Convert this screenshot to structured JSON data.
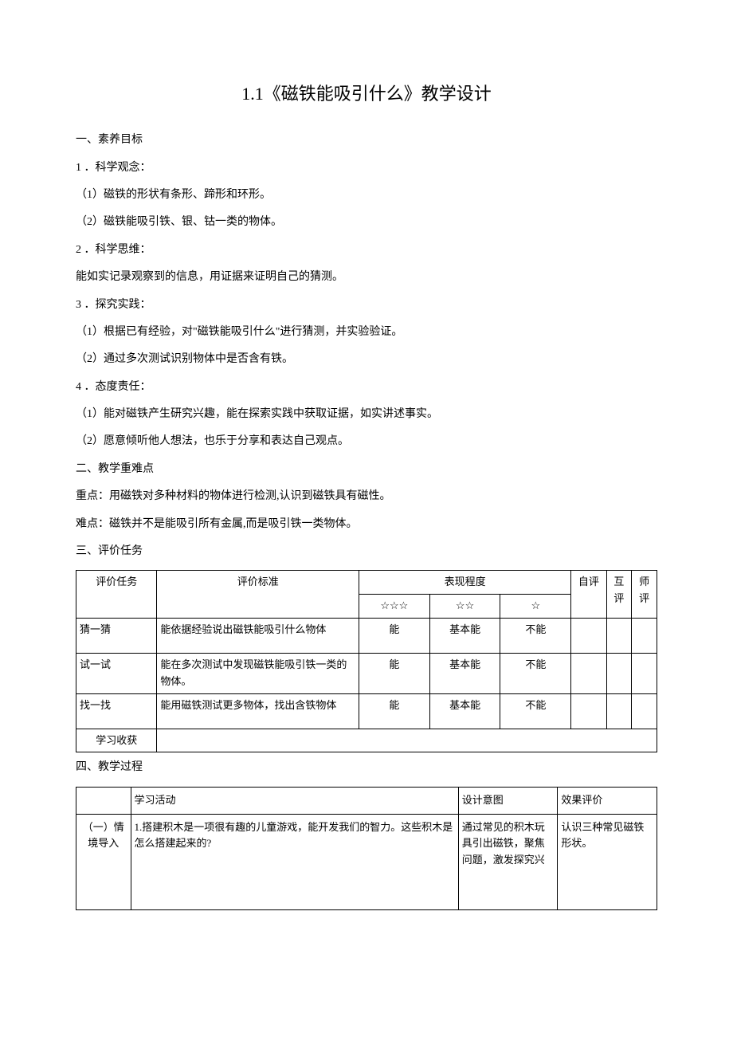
{
  "title": "1.1《磁铁能吸引什么》教学设计",
  "sec1": {
    "heading": "一、素养目标",
    "item1": "1 ．科学观念：",
    "item1_1": "（1）磁铁的形状有条形、蹄形和环形。",
    "item1_2": "（2）磁铁能吸引铁、银、钴一类的物体。",
    "item2": "2 ．科学思维：",
    "item2_1": "能如实记录观察到的信息，用证据来证明自己的猜测。",
    "item3": "3 ．探究实践：",
    "item3_1": "（1）根据已有经验，对\"磁铁能吸引什么\"进行猜测，并实验验证。",
    "item3_2": "（2）通过多次测试识别物体中是否含有铁。",
    "item4": "4 ．态度责任：",
    "item4_1": "（1）能对磁铁产生研究兴趣，能在探索实践中获取证据，如实讲述事实。",
    "item4_2": "（2）愿意倾听他人想法，也乐于分享和表达自己观点。"
  },
  "sec2": {
    "heading": "二、教学重难点",
    "line1": "重点：用磁铁对多种材料的物体进行检测,认识到磁铁具有磁性。",
    "line2": "难点：磁铁并不是能吸引所有金属,而是吸引铁一类物体。"
  },
  "sec3": {
    "heading": "三、评价任务",
    "t1": {
      "h_task": "评价任务",
      "h_std": "评价标准",
      "h_perf": "表现程度",
      "h_self": "自评",
      "h_peer": "互评",
      "h_teacher": "师评",
      "star3": "☆☆☆",
      "star2": "☆☆",
      "star1": "☆",
      "r1_task": "猜一猜",
      "r1_std": "能依据经验说出磁铁能吸引什么物体",
      "r1_p1": "能",
      "r1_p2": "基本能",
      "r1_p3": "不能",
      "r2_task": "试一试",
      "r2_std": "能在多次测试中发现磁铁能吸引铁一类的物体。",
      "r2_p1": "能",
      "r2_p2": "基本能",
      "r2_p3": "不能",
      "r3_task": "找一找",
      "r3_std": "能用磁铁测试更多物体，找出含铁物体",
      "r3_p1": "能",
      "r3_p2": "基本能",
      "r3_p3": "不能",
      "gain": "学习收获"
    }
  },
  "sec4": {
    "heading": "四、教学过程",
    "t2": {
      "h_activity": "学习活动",
      "h_intent": "设计意图",
      "h_eval": "效果评价",
      "r1_phase": "（一）情境导入",
      "r1_activity": "1.搭建积木是一项很有趣的儿童游戏，能开发我们的智力。这些积木是怎么搭建起来的?",
      "r1_intent": "通过常见的积木玩具引出磁铁，聚焦问题，激发探究兴",
      "r1_eval": "认识三种常见磁铁形状。"
    }
  }
}
